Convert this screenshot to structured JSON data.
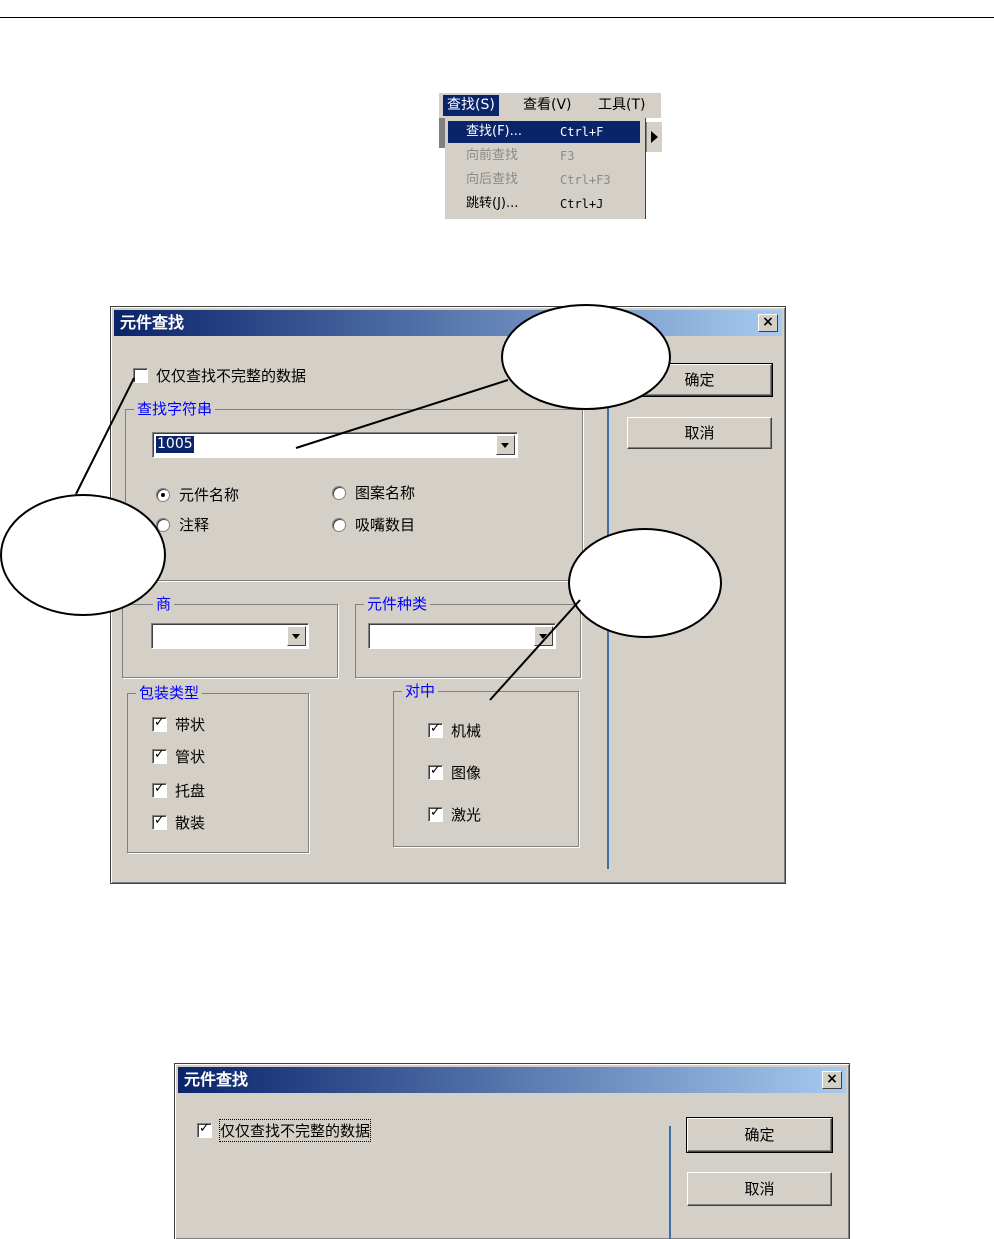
{
  "menu": {
    "bar": [
      "查找(S)",
      "查看(V)",
      "工具(T)"
    ],
    "items": [
      {
        "label": "查找(F)...",
        "shortcut": "Ctrl+F"
      },
      {
        "label": "向前查找",
        "shortcut": "F3"
      },
      {
        "label": "向后查找",
        "shortcut": "Ctrl+F3"
      },
      {
        "label": "跳转(J)...",
        "shortcut": "Ctrl+J"
      }
    ]
  },
  "dialog1": {
    "title": "元件查找",
    "close": "×",
    "incomplete_only_label": "仅仅查找不完整的数据",
    "ok_label": "确定",
    "cancel_label": "取消",
    "search_group_label": "查找字符串",
    "search_value": "1005",
    "radio": {
      "component_name": "元件名称",
      "pattern_name": "图案名称",
      "comment": "注释",
      "nozzle_count": "吸嘴数目"
    },
    "maker_group_label": "商",
    "type_group_label": "元件种类",
    "package_group_label": "包装类型",
    "package": [
      "带状",
      "管状",
      "托盘",
      "散装"
    ],
    "center_group_label": "对中",
    "center": [
      "机械",
      "图像",
      "激光"
    ]
  },
  "dialog2": {
    "title": "元件查找",
    "close": "×",
    "incomplete_only_label": "仅仅查找不完整的数据",
    "ok_label": "确定",
    "cancel_label": "取消"
  },
  "colors": {
    "titlebar_start": "#0a246a",
    "titlebar_end": "#a6caf0",
    "dialog_face": "#d4d0c8",
    "group_label": "#0000ff"
  }
}
